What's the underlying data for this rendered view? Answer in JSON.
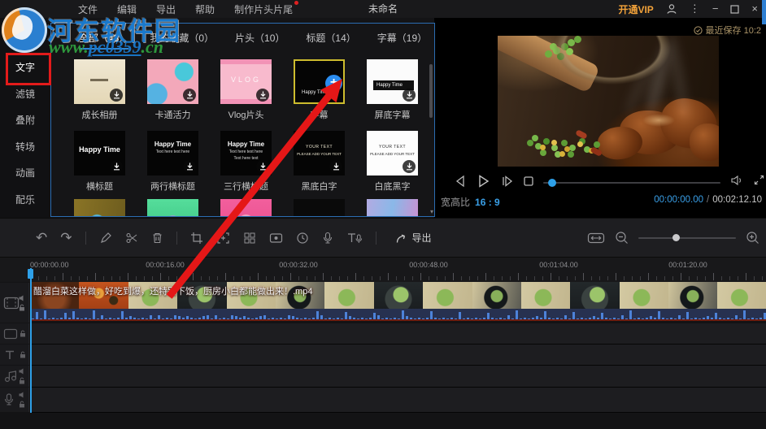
{
  "titlebar": {
    "menu": [
      {
        "label": "文件",
        "badge": false
      },
      {
        "label": "编辑",
        "badge": false
      },
      {
        "label": "导出",
        "badge": false
      },
      {
        "label": "帮助",
        "badge": false
      },
      {
        "label": "制作片头片尾",
        "badge": true
      }
    ],
    "title": "未命名",
    "vip_label": "开通VIP",
    "window_icons": [
      "user-icon",
      "more-icon",
      "minimize-icon",
      "maximize-icon",
      "close-icon"
    ],
    "minimize_glyph": "−",
    "more_glyph": "⋮",
    "close_glyph": "×"
  },
  "watermark": {
    "site_name": "河东软件园",
    "url_prefix": "www.",
    "url_mid": "pc0359",
    "url_suffix": ".cn"
  },
  "preview": {
    "saved_status": "最近保存 10:2",
    "aspect_label": "宽高比",
    "aspect_value": "16 : 9",
    "time_current": "00:00:00.00",
    "time_separator": "/",
    "time_total": "00:02:12.10"
  },
  "sidebar": {
    "items": [
      "文字",
      "滤镜",
      "叠附",
      "转场",
      "动画",
      "配乐"
    ],
    "active_item": "文字"
  },
  "panel": {
    "tabs": [
      {
        "label": "全部（43）",
        "active": true
      },
      {
        "label": "我的收藏（0）",
        "active": false
      },
      {
        "label": "片头（10）",
        "active": false
      },
      {
        "label": "标题（14）",
        "active": false
      },
      {
        "label": "字幕（19）",
        "active": false
      }
    ],
    "templates": [
      {
        "label": "成长相册",
        "style": "paper",
        "lines": [],
        "badge": "download",
        "selected": false
      },
      {
        "label": "卡通活力",
        "style": "cartoon",
        "lines": [],
        "badge": "download",
        "selected": false
      },
      {
        "label": "Vlog片头",
        "style": "vlog",
        "lines": [
          "VLOG"
        ],
        "badge": "download",
        "selected": false
      },
      {
        "label": "字幕",
        "style": "black-sub",
        "lines": [
          "Happy Time"
        ],
        "badge": "add",
        "selected": true
      },
      {
        "label": "屏底字幕",
        "style": "ribbon",
        "lines": [
          "Happy Time"
        ],
        "badge": "download",
        "selected": false
      },
      {
        "label": "横标题",
        "style": "title1",
        "lines": [
          "Happy Time"
        ],
        "badge": "download",
        "selected": false
      },
      {
        "label": "两行横标题",
        "style": "title2",
        "lines": [
          "Happy Time",
          "Text here text here"
        ],
        "badge": "download",
        "selected": false
      },
      {
        "label": "三行横标题",
        "style": "title3",
        "lines": [
          "Happy Time",
          "Text here text here",
          "Text here text"
        ],
        "badge": "download",
        "selected": false
      },
      {
        "label": "黑底白字",
        "style": "dark-your",
        "lines": [
          "YOUR TEXT",
          "PLEASE ADD YOUR TEXT"
        ],
        "badge": "download",
        "selected": false
      },
      {
        "label": "白底黑字",
        "style": "light-your",
        "lines": [
          "YOUR TEXT",
          "PLEASE ADD YOUR TEXT"
        ],
        "badge": "download",
        "selected": false
      }
    ],
    "partial_row_styles": [
      "gold",
      "mint",
      "pink",
      "dark",
      "violet"
    ],
    "add_glyph": "+",
    "scroll_down_glyph": "▾"
  },
  "toolbar": {
    "export_label": "导出",
    "icons": [
      "undo-icon",
      "redo-icon",
      "edit-pen-icon",
      "split-scissors-icon",
      "delete-trash-icon",
      "crop-icon",
      "zoom-crop-icon",
      "mosaic-icon",
      "screen-record-icon",
      "duration-clock-icon",
      "voiceover-mic-icon",
      "text-to-speech-icon",
      "export-icon",
      "fit-timeline-icon",
      "zoom-out-icon",
      "zoom-in-icon"
    ],
    "undo_glyph": "↶",
    "redo_glyph": "↷"
  },
  "timeline": {
    "ruler_labels": [
      "00:00:00.00",
      "00:00:16.00",
      "00:00:32.00",
      "00:00:48.00",
      "00:01:04.00",
      "00:01:20.00"
    ],
    "clip_name": "醋溜白菜这样做，好吃到爆，还特别下饭，厨房小白都能做出来！.mp4",
    "track_icons": [
      "video-track-icon",
      "overlay-track-icon",
      "text-track-icon",
      "audio-track-icon",
      "voiceover-track-icon"
    ]
  },
  "colors": {
    "accent_blue": "#2ea0e8",
    "vip_orange": "#f2a23a",
    "annotation_red": "#e31b1b",
    "selected_template_yellow": "#cdbc2e",
    "add_button_blue": "#2b8df0"
  }
}
